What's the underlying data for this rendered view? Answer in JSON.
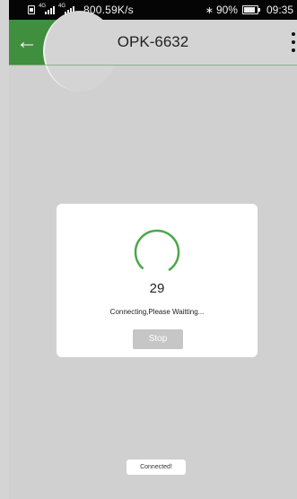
{
  "status_bar": {
    "net_speed": "800.59K/s",
    "network_type": "4G",
    "bluetooth_icon": "bluetooth-icon",
    "battery_percent": "90%",
    "time": "09:35"
  },
  "header": {
    "title": "OPK-6632",
    "back_icon": "back-arrow-icon",
    "menu_icon": "more-vert-icon",
    "accent_color": "#3f8f3f"
  },
  "dialog": {
    "countdown": "29",
    "message": "Connecting,Please Waitting...",
    "stop_label": "Stop",
    "spinner_color": "#4aa84a"
  },
  "toast": {
    "message": "Connected!"
  }
}
